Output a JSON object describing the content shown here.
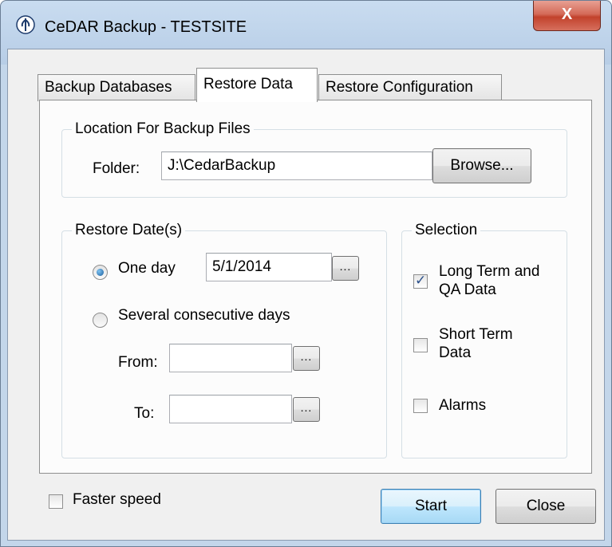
{
  "window": {
    "title": "CeDAR Backup - TESTSITE",
    "close_label": "X"
  },
  "tabs": [
    {
      "label": "Backup Databases",
      "active": false
    },
    {
      "label": "Restore Data",
      "active": true
    },
    {
      "label": "Restore Configuration",
      "active": false
    }
  ],
  "location_group": {
    "legend": "Location For Backup Files",
    "folder_label": "Folder:",
    "folder_value": "J:\\CedarBackup",
    "browse_label": "Browse..."
  },
  "restore_dates": {
    "legend": "Restore Date(s)",
    "one_day_label": "One day",
    "one_day_selected": true,
    "one_day_value": "5/1/2014",
    "several_days_label": "Several consecutive days",
    "several_days_selected": false,
    "from_label": "From:",
    "from_value": "",
    "to_label": "To:",
    "to_value": "",
    "picker_label": "..."
  },
  "selection": {
    "legend": "Selection",
    "long_term_label_line1": "Long Term and",
    "long_term_label_line2": "QA Data",
    "long_term_checked": true,
    "short_term_label_line1": "Short Term",
    "short_term_label_line2": "Data",
    "short_term_checked": false,
    "alarms_label": "Alarms",
    "alarms_checked": false
  },
  "footer": {
    "faster_speed_label": "Faster speed",
    "faster_speed_checked": false,
    "start_label": "Start",
    "close_label": "Close"
  }
}
